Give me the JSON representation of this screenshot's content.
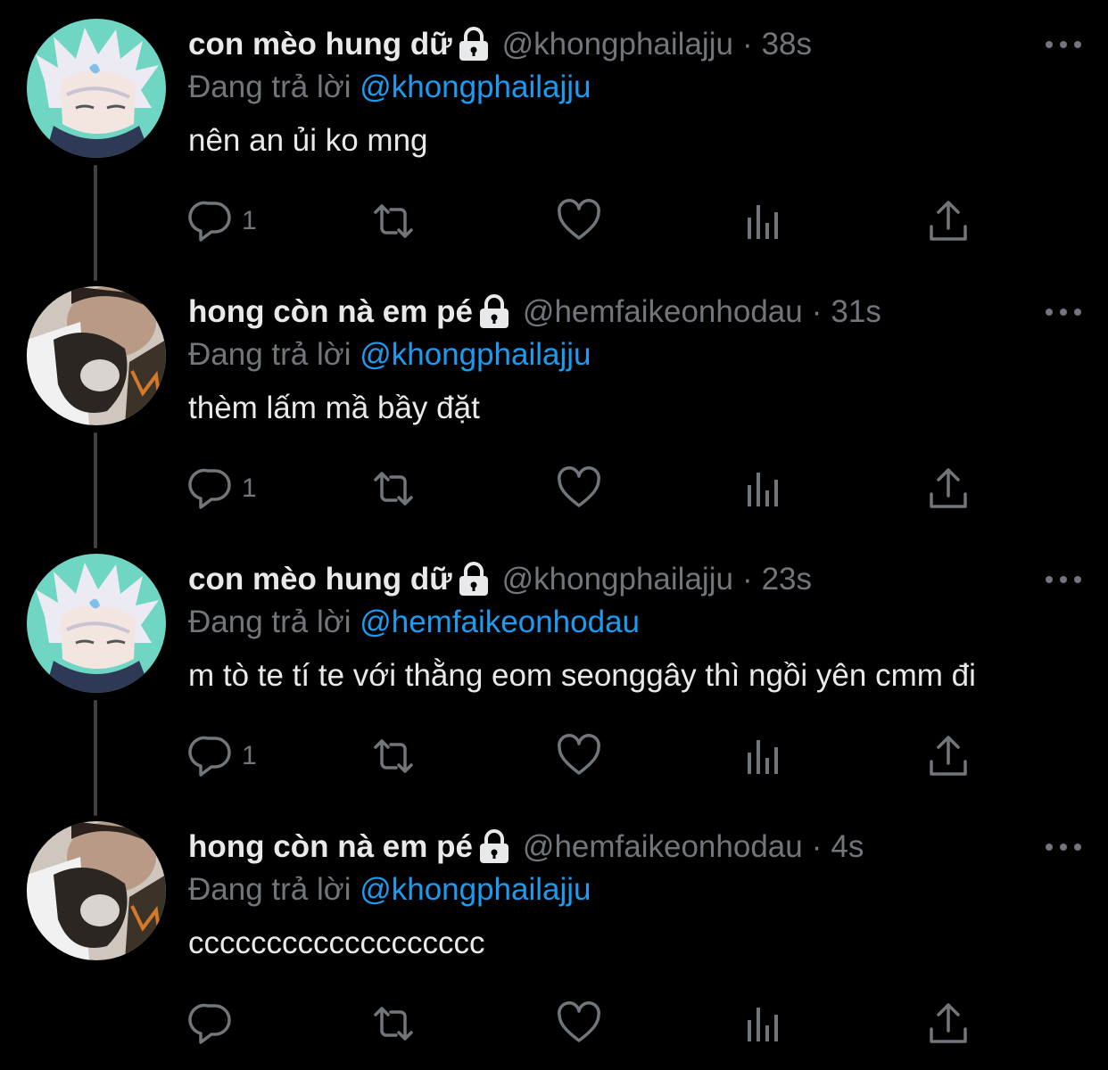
{
  "colors": {
    "background": "#000000",
    "text_primary": "#e7e9ea",
    "text_secondary": "#71767b",
    "mention": "#1d9bf0",
    "thread_line": "#3e4144"
  },
  "icons": {
    "lock": "lock-icon",
    "more": "more-horizontal-icon",
    "reply": "reply-icon",
    "retweet": "retweet-icon",
    "like": "heart-icon",
    "views": "views-icon",
    "share": "share-icon"
  },
  "reply_prefix": "Đang trả lời",
  "tweets": [
    {
      "display_name": "con mèo hung dữ",
      "handle": "@khongphailajju",
      "separator": "·",
      "time": "38s",
      "reply_to": "@khongphailajju",
      "text": "nên an ủi ko mng",
      "reply_count": "1"
    },
    {
      "display_name": "hong còn nà em pé",
      "handle": "@hemfaikeonhodau",
      "separator": "·",
      "time": "31s",
      "reply_to": "@khongphailajju",
      "text": "thèm lấm mầ bầy đặt",
      "reply_count": "1"
    },
    {
      "display_name": "con mèo hung dữ",
      "handle": "@khongphailajju",
      "separator": "·",
      "time": "23s",
      "reply_to": "@hemfaikeonhodau",
      "text": "m tò te tí te với thằng eom seonggây thì ngồi yên cmm đi",
      "reply_count": "1"
    },
    {
      "display_name": "hong còn nà em pé",
      "handle": "@hemfaikeonhodau",
      "separator": "·",
      "time": "4s",
      "reply_to": "@khongphailajju",
      "text": "ccccccccccccccccccc",
      "reply_count": ""
    }
  ]
}
